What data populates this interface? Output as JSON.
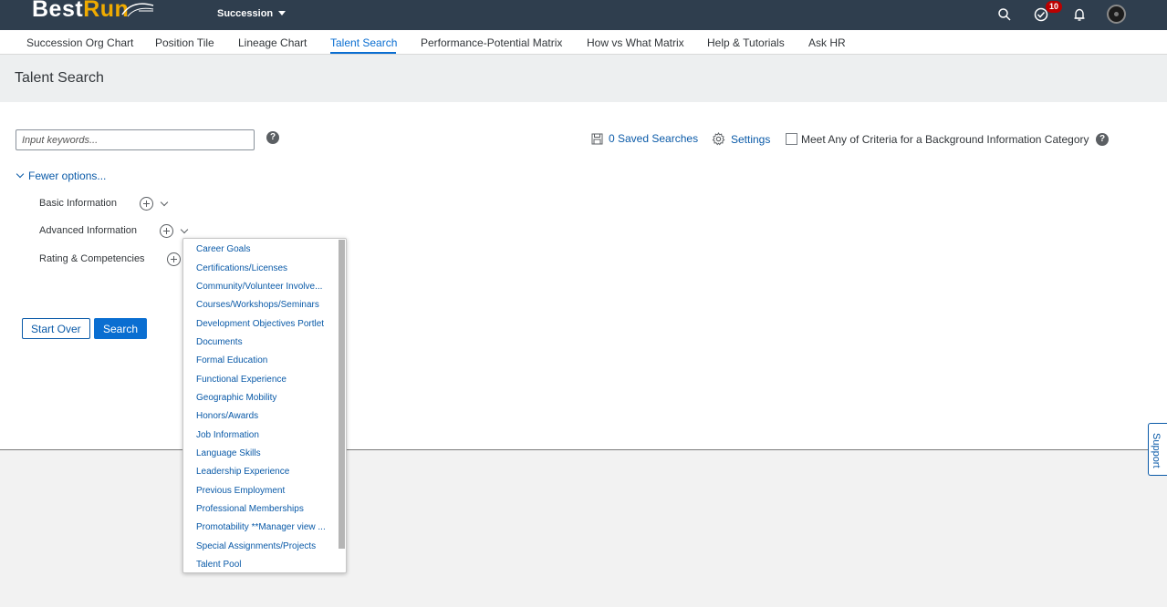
{
  "shell": {
    "logo_main": "Best",
    "logo_accent": "Run",
    "module": "Succession",
    "notification_count": "10"
  },
  "tabs": [
    {
      "label": "Succession Org Chart"
    },
    {
      "label": "Position Tile"
    },
    {
      "label": "Lineage Chart"
    },
    {
      "label": "Talent Search",
      "active": true
    },
    {
      "label": "Performance-Potential Matrix"
    },
    {
      "label": "How vs What Matrix"
    },
    {
      "label": "Help & Tutorials"
    },
    {
      "label": "Ask HR"
    }
  ],
  "page": {
    "title": "Talent Search"
  },
  "search": {
    "placeholder": "Input keywords...",
    "help": "?",
    "saved_searches": "0 Saved Searches",
    "settings": "Settings",
    "meet_any_label": "Meet Any of Criteria for a Background Information Category",
    "fewer_options": "Fewer options..."
  },
  "criteria": [
    {
      "label": "Basic Information"
    },
    {
      "label": "Advanced Information"
    },
    {
      "label": "Rating & Competencies"
    }
  ],
  "buttons": {
    "start_over": "Start Over",
    "search": "Search"
  },
  "dropdown_items": [
    "Career Goals",
    "Certifications/Licenses",
    "Community/Volunteer Involve...",
    "Courses/Workshops/Seminars",
    "Development Objectives Portlet",
    "Documents",
    "Formal Education",
    "Functional Experience",
    "Geographic Mobility",
    "Honors/Awards",
    "Job Information",
    "Language Skills",
    "Leadership Experience",
    "Previous Employment",
    "Professional Memberships",
    "Promotability **Manager view ...",
    "Special Assignments/Projects",
    "Talent Pool"
  ],
  "support": "Support",
  "colors": {
    "shell": "#2f3e4e",
    "link": "#0a5aa8",
    "primary": "#0a6ed1",
    "logo_accent": "#f0ab00",
    "badge": "#bb0000"
  }
}
